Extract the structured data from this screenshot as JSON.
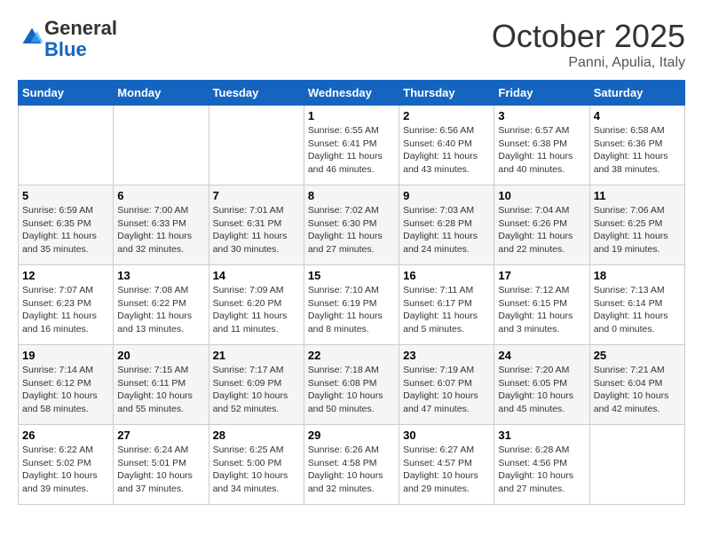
{
  "logo": {
    "general": "General",
    "blue": "Blue"
  },
  "header": {
    "month": "October 2025",
    "location": "Panni, Apulia, Italy"
  },
  "days_of_week": [
    "Sunday",
    "Monday",
    "Tuesday",
    "Wednesday",
    "Thursday",
    "Friday",
    "Saturday"
  ],
  "weeks": [
    [
      {
        "day": "",
        "info": ""
      },
      {
        "day": "",
        "info": ""
      },
      {
        "day": "",
        "info": ""
      },
      {
        "day": "1",
        "info": "Sunrise: 6:55 AM\nSunset: 6:41 PM\nDaylight: 11 hours\nand 46 minutes."
      },
      {
        "day": "2",
        "info": "Sunrise: 6:56 AM\nSunset: 6:40 PM\nDaylight: 11 hours\nand 43 minutes."
      },
      {
        "day": "3",
        "info": "Sunrise: 6:57 AM\nSunset: 6:38 PM\nDaylight: 11 hours\nand 40 minutes."
      },
      {
        "day": "4",
        "info": "Sunrise: 6:58 AM\nSunset: 6:36 PM\nDaylight: 11 hours\nand 38 minutes."
      }
    ],
    [
      {
        "day": "5",
        "info": "Sunrise: 6:59 AM\nSunset: 6:35 PM\nDaylight: 11 hours\nand 35 minutes."
      },
      {
        "day": "6",
        "info": "Sunrise: 7:00 AM\nSunset: 6:33 PM\nDaylight: 11 hours\nand 32 minutes."
      },
      {
        "day": "7",
        "info": "Sunrise: 7:01 AM\nSunset: 6:31 PM\nDaylight: 11 hours\nand 30 minutes."
      },
      {
        "day": "8",
        "info": "Sunrise: 7:02 AM\nSunset: 6:30 PM\nDaylight: 11 hours\nand 27 minutes."
      },
      {
        "day": "9",
        "info": "Sunrise: 7:03 AM\nSunset: 6:28 PM\nDaylight: 11 hours\nand 24 minutes."
      },
      {
        "day": "10",
        "info": "Sunrise: 7:04 AM\nSunset: 6:26 PM\nDaylight: 11 hours\nand 22 minutes."
      },
      {
        "day": "11",
        "info": "Sunrise: 7:06 AM\nSunset: 6:25 PM\nDaylight: 11 hours\nand 19 minutes."
      }
    ],
    [
      {
        "day": "12",
        "info": "Sunrise: 7:07 AM\nSunset: 6:23 PM\nDaylight: 11 hours\nand 16 minutes."
      },
      {
        "day": "13",
        "info": "Sunrise: 7:08 AM\nSunset: 6:22 PM\nDaylight: 11 hours\nand 13 minutes."
      },
      {
        "day": "14",
        "info": "Sunrise: 7:09 AM\nSunset: 6:20 PM\nDaylight: 11 hours\nand 11 minutes."
      },
      {
        "day": "15",
        "info": "Sunrise: 7:10 AM\nSunset: 6:19 PM\nDaylight: 11 hours\nand 8 minutes."
      },
      {
        "day": "16",
        "info": "Sunrise: 7:11 AM\nSunset: 6:17 PM\nDaylight: 11 hours\nand 5 minutes."
      },
      {
        "day": "17",
        "info": "Sunrise: 7:12 AM\nSunset: 6:15 PM\nDaylight: 11 hours\nand 3 minutes."
      },
      {
        "day": "18",
        "info": "Sunrise: 7:13 AM\nSunset: 6:14 PM\nDaylight: 11 hours\nand 0 minutes."
      }
    ],
    [
      {
        "day": "19",
        "info": "Sunrise: 7:14 AM\nSunset: 6:12 PM\nDaylight: 10 hours\nand 58 minutes."
      },
      {
        "day": "20",
        "info": "Sunrise: 7:15 AM\nSunset: 6:11 PM\nDaylight: 10 hours\nand 55 minutes."
      },
      {
        "day": "21",
        "info": "Sunrise: 7:17 AM\nSunset: 6:09 PM\nDaylight: 10 hours\nand 52 minutes."
      },
      {
        "day": "22",
        "info": "Sunrise: 7:18 AM\nSunset: 6:08 PM\nDaylight: 10 hours\nand 50 minutes."
      },
      {
        "day": "23",
        "info": "Sunrise: 7:19 AM\nSunset: 6:07 PM\nDaylight: 10 hours\nand 47 minutes."
      },
      {
        "day": "24",
        "info": "Sunrise: 7:20 AM\nSunset: 6:05 PM\nDaylight: 10 hours\nand 45 minutes."
      },
      {
        "day": "25",
        "info": "Sunrise: 7:21 AM\nSunset: 6:04 PM\nDaylight: 10 hours\nand 42 minutes."
      }
    ],
    [
      {
        "day": "26",
        "info": "Sunrise: 6:22 AM\nSunset: 5:02 PM\nDaylight: 10 hours\nand 39 minutes."
      },
      {
        "day": "27",
        "info": "Sunrise: 6:24 AM\nSunset: 5:01 PM\nDaylight: 10 hours\nand 37 minutes."
      },
      {
        "day": "28",
        "info": "Sunrise: 6:25 AM\nSunset: 5:00 PM\nDaylight: 10 hours\nand 34 minutes."
      },
      {
        "day": "29",
        "info": "Sunrise: 6:26 AM\nSunset: 4:58 PM\nDaylight: 10 hours\nand 32 minutes."
      },
      {
        "day": "30",
        "info": "Sunrise: 6:27 AM\nSunset: 4:57 PM\nDaylight: 10 hours\nand 29 minutes."
      },
      {
        "day": "31",
        "info": "Sunrise: 6:28 AM\nSunset: 4:56 PM\nDaylight: 10 hours\nand 27 minutes."
      },
      {
        "day": "",
        "info": ""
      }
    ]
  ]
}
